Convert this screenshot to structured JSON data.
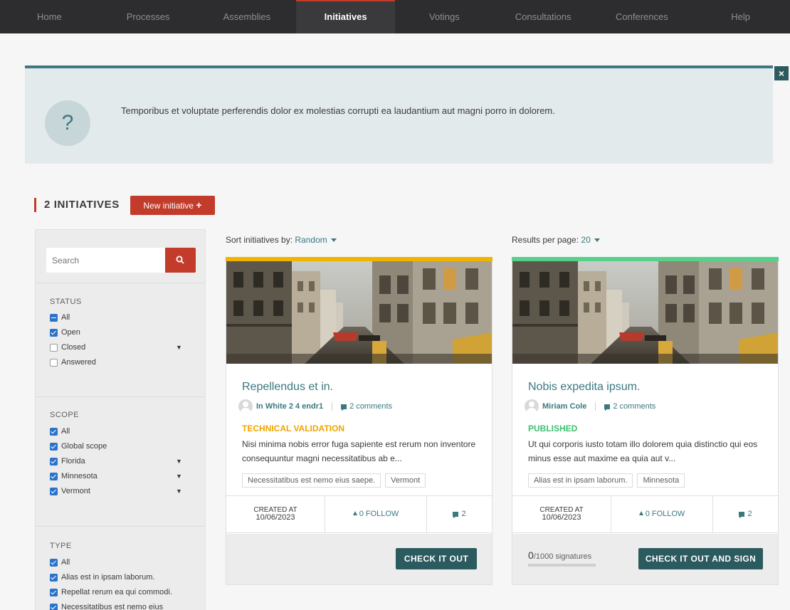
{
  "nav": {
    "items": [
      {
        "label": "Home",
        "name": "nav-home"
      },
      {
        "label": "Processes",
        "name": "nav-processes"
      },
      {
        "label": "Assemblies",
        "name": "nav-assemblies"
      },
      {
        "label": "Initiatives",
        "name": "nav-initiatives"
      },
      {
        "label": "Votings",
        "name": "nav-votings"
      },
      {
        "label": "Consultations",
        "name": "nav-consultations"
      },
      {
        "label": "Conferences",
        "name": "nav-conferences"
      },
      {
        "label": "Help",
        "name": "nav-help"
      }
    ],
    "active": "Initiatives"
  },
  "callout": {
    "icon": "question-icon",
    "glyph": "?",
    "message": "Temporibus et voluptate perferendis dolor ex molestias corrupti ea laudantium aut magni porro in dolorem.",
    "close": "×"
  },
  "heading": {
    "count": "2 INITIATIVES",
    "new_button": "New initiative"
  },
  "filters": {
    "search_placeholder": "Search",
    "status": {
      "title": "STATUS",
      "options": [
        {
          "label": "All",
          "state": "partial"
        },
        {
          "label": "Open",
          "state": "checked"
        },
        {
          "label": "Closed",
          "state": "unchecked"
        },
        {
          "label": "Answered",
          "state": "unchecked"
        }
      ]
    },
    "scope": {
      "title": "SCOPE",
      "options": [
        {
          "label": "All",
          "state": "checked"
        },
        {
          "label": "Global scope",
          "state": "checked"
        },
        {
          "label": "Florida",
          "state": "checked"
        },
        {
          "label": "Minnesota",
          "state": "checked"
        },
        {
          "label": "Vermont",
          "state": "checked"
        }
      ]
    },
    "type": {
      "title": "TYPE",
      "options": [
        {
          "label": "All",
          "state": "checked"
        },
        {
          "label": "Alias est in ipsam laborum.",
          "state": "checked"
        },
        {
          "label": "Repellat rerum ea qui commodi.",
          "state": "checked"
        },
        {
          "label": "Necessitatibus est nemo eius",
          "state": "checked"
        }
      ]
    }
  },
  "sort": {
    "label": "Sort initiatives by:",
    "value": "Random"
  },
  "results": {
    "label": "Results per page:",
    "value": "20"
  },
  "cards": [
    {
      "bar_color": "#f0b400",
      "title": "Repellendus et in.",
      "author": "In White 2 4 endr1",
      "comments": "2 comments",
      "state": "TECHNICAL VALIDATION",
      "state_color": "#f0a500",
      "body": "Nisi minima nobis error fuga sapiente est rerum non in­ventore consequuntur magni necessitatibus ab e...",
      "tags": [
        "Necessitatibus est nemo eius saepe.",
        "Vermont"
      ],
      "created_label": "CREATED AT",
      "created_date": "10/06/2023",
      "follow": "0 FOLLOW",
      "comment_count": "2",
      "cta": "CHECK IT OUT"
    },
    {
      "bar_color": "#57d08a",
      "title": "Nobis expedita ipsum.",
      "author": "Miriam Cole",
      "comments": "2 comments",
      "state": "PUBLISHED",
      "state_color": "#3fbf6f",
      "body": "Ut qui corporis iusto totam illo dolorem quia distinctio qui eos minus esse aut maxime ea quia aut v...",
      "tags": [
        "Alias est in ipsam laborum.",
        "Minnesota"
      ],
      "created_label": "CREATED AT",
      "created_date": "10/06/2023",
      "follow": "0 FOLLOW",
      "comment_count": "2",
      "signatures_count": "0",
      "signatures_total": "/1000 signatures",
      "cta": "CHECK IT OUT AND SIGN"
    }
  ],
  "colors": {
    "primary": "#3b7980",
    "accent": "#c23b2b",
    "dark": "#2b5a5f",
    "checkbox": "#2b73c9"
  }
}
